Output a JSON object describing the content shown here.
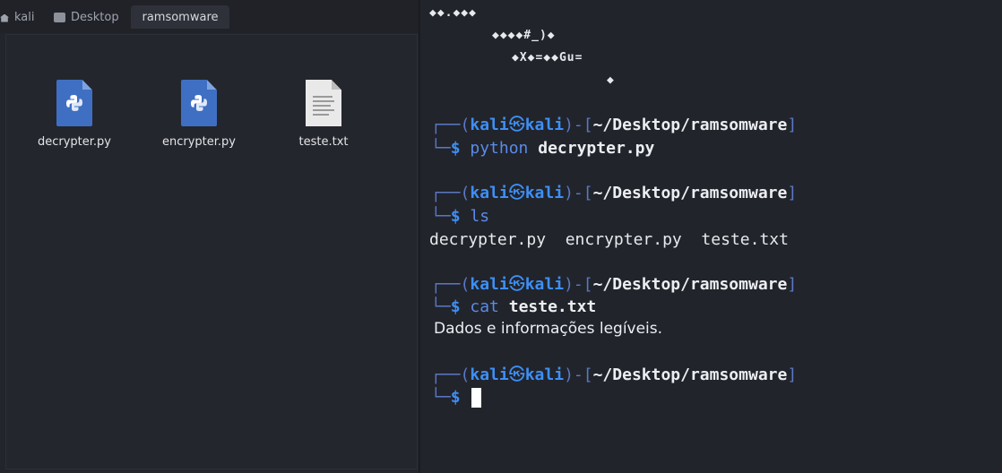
{
  "file_manager": {
    "breadcrumbs": [
      {
        "label": "kali",
        "icon": "home-icon"
      },
      {
        "label": "Desktop",
        "icon": "folder-icon"
      },
      {
        "label": "ramsomware",
        "icon": null
      }
    ],
    "files": [
      {
        "name": "decrypter.py",
        "icon": "python-file-icon"
      },
      {
        "name": "encrypter.py",
        "icon": "python-file-icon"
      },
      {
        "name": "teste.txt",
        "icon": "text-file-icon"
      }
    ]
  },
  "terminal": {
    "garbage_lines": [
      "◆◆.◆◆◆",
      "◆◆◆◆#_)◆",
      "◆X◆=◆◆Gu=",
      "◆"
    ],
    "prompt": {
      "user": "kali",
      "host": "kali",
      "at_symbol": "㉿",
      "path": "~/Desktop/ramsomware",
      "dollar": "$"
    },
    "commands": [
      {
        "cmd": "python",
        "arg": "decrypter.py",
        "output": ""
      },
      {
        "cmd": "ls",
        "arg": "",
        "output": "decrypter.py  encrypter.py  teste.txt"
      },
      {
        "cmd": "cat",
        "arg": "teste.txt",
        "output": "Dados e informações legíveis."
      }
    ]
  },
  "colors": {
    "prompt_user": "#3e8ff5",
    "prompt_bracket": "#5b78c4",
    "background": "#21242b"
  }
}
